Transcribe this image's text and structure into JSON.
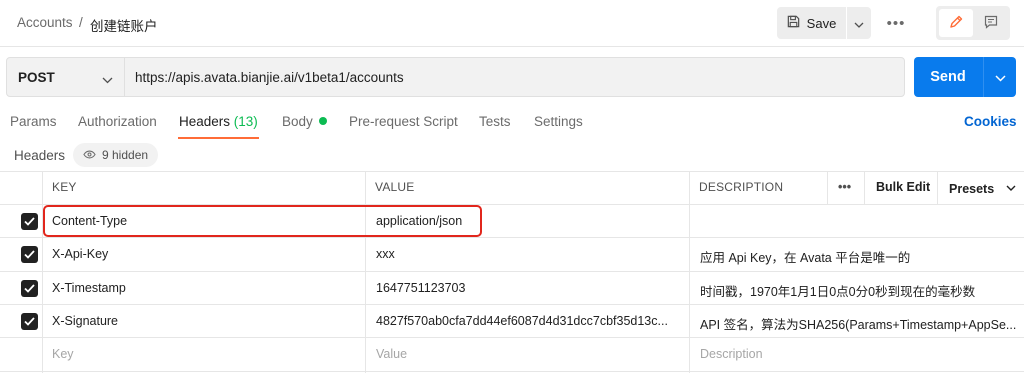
{
  "breadcrumb": {
    "parent": "Accounts",
    "separator": "/",
    "current": "创建链账户"
  },
  "toolbar": {
    "save_label": "Save",
    "more_label": "•••"
  },
  "request": {
    "method": "POST",
    "url": "https://apis.avata.bianjie.ai/v1beta1/accounts",
    "send_label": "Send"
  },
  "tabs": {
    "params": "Params",
    "authorization": "Authorization",
    "headers": "Headers",
    "headers_count": "(13)",
    "body": "Body",
    "prerequest": "Pre-request Script",
    "tests": "Tests",
    "settings": "Settings",
    "cookies": "Cookies",
    "active": "Headers"
  },
  "headers_section": {
    "title": "Headers",
    "hidden_label": "9 hidden"
  },
  "table": {
    "columns": {
      "key": "KEY",
      "value": "VALUE",
      "description": "DESCRIPTION"
    },
    "actions": {
      "more": "•••",
      "bulk_edit": "Bulk Edit",
      "presets": "Presets"
    },
    "rows": [
      {
        "checked": true,
        "key": "Content-Type",
        "value": "application/json",
        "description": ""
      },
      {
        "checked": true,
        "key": "X-Api-Key",
        "value": "xxx",
        "description": "应用 Api Key，在 Avata 平台是唯一的"
      },
      {
        "checked": true,
        "key": "X-Timestamp",
        "value": "1647751123703",
        "description": "时间戳，1970年1月1日0点0分0秒到现在的毫秒数"
      },
      {
        "checked": true,
        "key": "X-Signature",
        "value": "4827f570ab0cfa7dd44ef6087d4d31dcc7cbf35d13c...",
        "description": "API 签名，算法为SHA256(Params+Timestamp+AppSe..."
      }
    ],
    "placeholder": {
      "key": "Key",
      "value": "Value",
      "description": "Description"
    }
  },
  "colors": {
    "accent": "#ff6c37",
    "primary": "#097bed",
    "success": "#0cbb52",
    "highlight": "#e1261c",
    "link": "#0265d2"
  }
}
